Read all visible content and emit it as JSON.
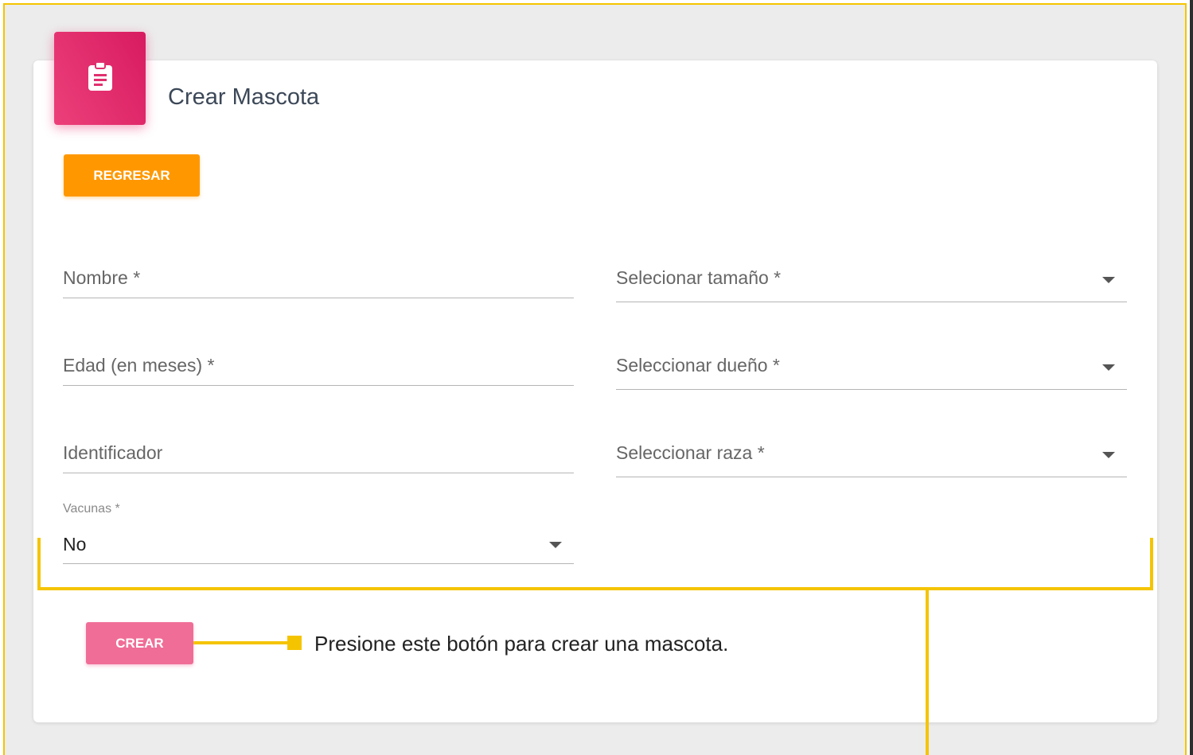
{
  "card": {
    "title": "Crear Mascota",
    "icon": "clipboard-icon"
  },
  "buttons": {
    "back_label": "REGRESAR",
    "create_label": "CREAR"
  },
  "fields": {
    "name": {
      "label": "Nombre *"
    },
    "age": {
      "label": "Edad (en meses) *"
    },
    "identifier": {
      "label": "Identificador"
    },
    "size": {
      "label": "Selecionar tamaño *"
    },
    "owner": {
      "label": "Seleccionar dueño *"
    },
    "breed": {
      "label": "Seleccionar raza *"
    },
    "vaccines": {
      "label": "Vacunas *",
      "value": "No"
    }
  },
  "annotation": {
    "text": "Presione este botón para crear una mascota."
  },
  "colors": {
    "accent_pink": "#e91e63",
    "back_orange": "#ff9800",
    "annotation_yellow": "#f5c400"
  }
}
